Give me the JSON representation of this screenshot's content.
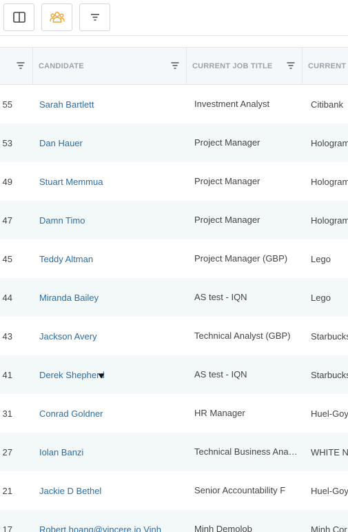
{
  "toolbar": {
    "buttons": [
      {
        "name": "columns-layout-button",
        "icon": "columns-icon"
      },
      {
        "name": "team-view-button",
        "icon": "team-icon",
        "accent": "#f0a030"
      },
      {
        "name": "filter-button",
        "icon": "filter-icon"
      }
    ]
  },
  "table": {
    "columns": [
      {
        "key": "id",
        "label": ""
      },
      {
        "key": "candidate",
        "label": "CANDIDATE"
      },
      {
        "key": "current_job_title",
        "label": "CURRENT JOB TITLE"
      },
      {
        "key": "current_employer",
        "label": "CURRENT E"
      }
    ],
    "rows": [
      {
        "id": "55",
        "candidate": "Sarah Bartlett",
        "title": "Investment Analyst",
        "company": "Citibank"
      },
      {
        "id": "53",
        "candidate": "Dan Hauer",
        "title": "Project Manager",
        "company": "Hologram"
      },
      {
        "id": "49",
        "candidate": "Stuart Memmua",
        "title": "Project Manager",
        "company": "Hologram"
      },
      {
        "id": "47",
        "candidate": "Damn Timo",
        "title": "Project Manager",
        "company": "Hologram"
      },
      {
        "id": "45",
        "candidate": "Teddy Altman",
        "title": "Project Manager (GBP)",
        "company": "Lego"
      },
      {
        "id": "44",
        "candidate": "Miranda Bailey",
        "title": "AS test - IQN",
        "company": "Lego"
      },
      {
        "id": "43",
        "candidate": "Jackson Avery",
        "title": "Technical Analyst (GBP)",
        "company": "Starbucks"
      },
      {
        "id": "41",
        "candidate": "Derek Shepherd",
        "title": "AS test - IQN",
        "company": "Starbucks"
      },
      {
        "id": "31",
        "candidate": "Conrad Goldner",
        "title": "HR Manager",
        "company": "Huel-Goy"
      },
      {
        "id": "27",
        "candidate": "Iolan Banzi",
        "title": "Technical Business Analyst",
        "company": "WHITE N"
      },
      {
        "id": "21",
        "candidate": "Jackie D Bethel",
        "title": "Senior Accountability F",
        "company": "Huel-Goy"
      },
      {
        "id": "17",
        "candidate": "Robert.hoang@vincere.io Vinh",
        "title": "Minh Demolob",
        "company": "Minh Cor"
      }
    ]
  },
  "colors": {
    "link": "#2a6ea8",
    "header_bg": "#f5f8fa",
    "row_alt_bg": "#f3f8f9",
    "accent": "#f0a030"
  }
}
